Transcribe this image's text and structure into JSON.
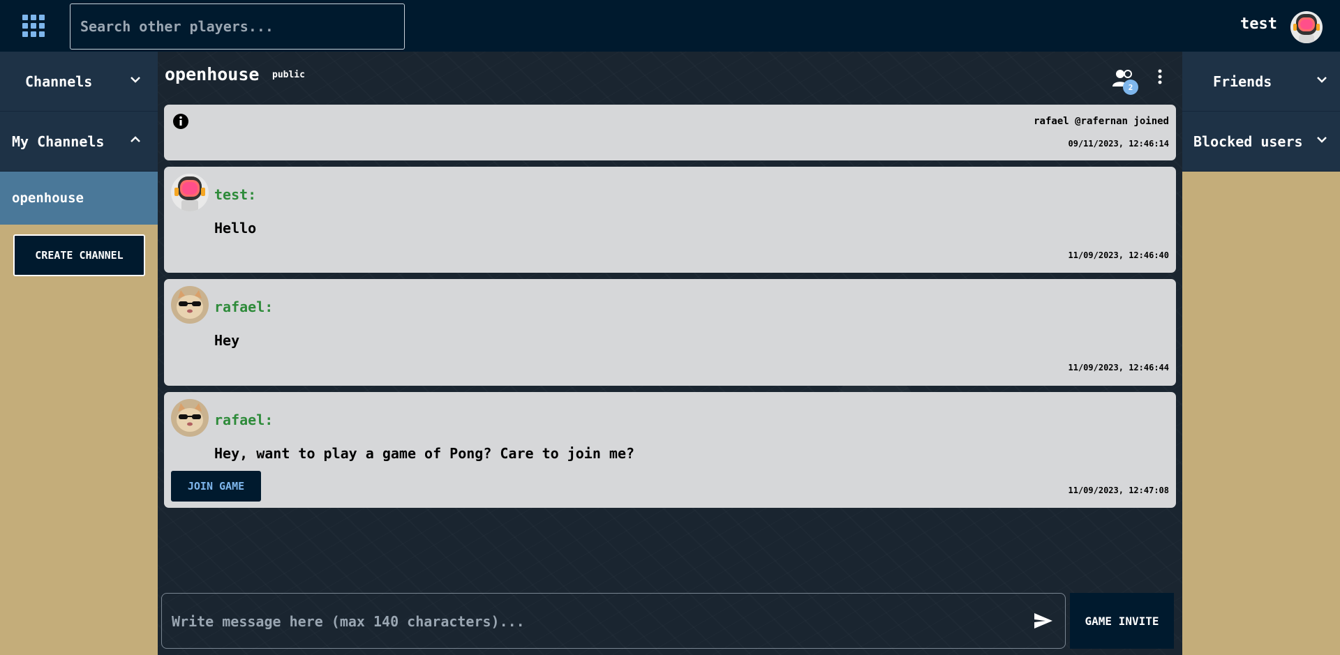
{
  "topbar": {
    "search_placeholder": "Search other players...",
    "username": "test"
  },
  "left_sidebar": {
    "channels_label": "Channels",
    "my_channels_label": "My Channels",
    "channels": [
      "openhouse"
    ],
    "create_channel_label": "CREATE CHANNEL"
  },
  "chat": {
    "title": "openhouse",
    "type": "public",
    "members_count": "2",
    "info_message": {
      "text": "rafael @rafernan joined",
      "timestamp": "09/11/2023, 12:46:14"
    },
    "messages": [
      {
        "author": "test:",
        "text": "Hello",
        "timestamp": "11/09/2023, 12:46:40",
        "avatar": "astronaut-avatar"
      },
      {
        "author": "rafael:",
        "text": "Hey",
        "timestamp": "11/09/2023, 12:46:44",
        "avatar": "cat-sunglasses-avatar"
      },
      {
        "author": "rafael:",
        "text": "Hey, want to play a game of Pong? Care to join me?",
        "timestamp": "11/09/2023, 12:47:08",
        "avatar": "cat-sunglasses-avatar",
        "action_label": "JOIN GAME"
      }
    ],
    "composer_placeholder": "Write message here (max 140 characters)...",
    "game_invite_label": "GAME INVITE"
  },
  "right_sidebar": {
    "friends_label": "Friends",
    "blocked_label": "Blocked users"
  },
  "colors": {
    "navy": "#001a2e",
    "panel": "#1e3246",
    "accent": "#7eb6ec",
    "author_green": "#2e8b3a",
    "background": "#c4ad7a"
  }
}
